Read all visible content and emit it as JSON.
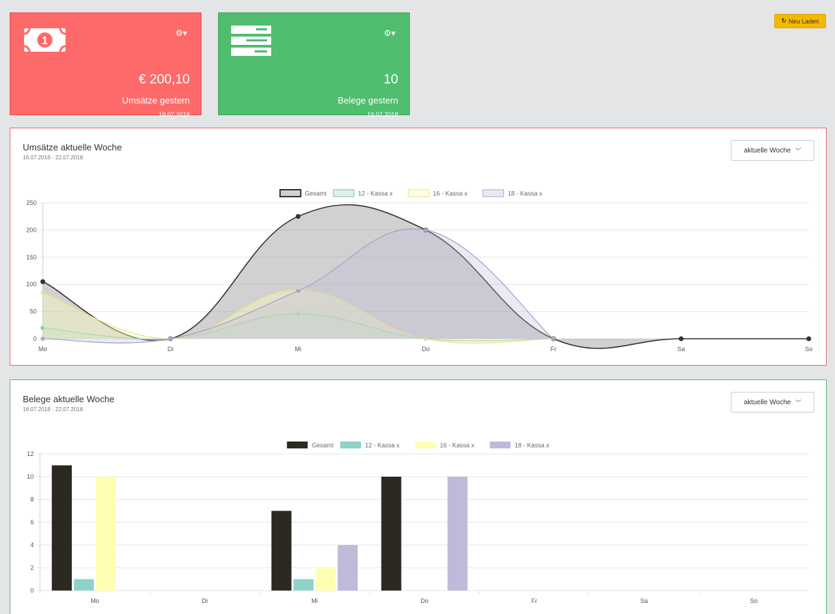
{
  "header": {
    "reload_label": "Neu Laden",
    "reload_icon": "refresh-icon"
  },
  "tiles": [
    {
      "icon": "banknote-icon",
      "value": "€ 200,10",
      "label": "Umsätze gestern",
      "date": "19.07.2018",
      "color": "#fd6a69"
    },
    {
      "icon": "receipts-icon",
      "value": "10",
      "label": "Belege gestern",
      "date": "19.07.2018",
      "color": "#50bd6f"
    }
  ],
  "panels": [
    {
      "title": "Umsätze aktuelle Woche",
      "subtitle": "16.07.2018 - 22.07.2018",
      "dropdown": "aktuelle Woche"
    },
    {
      "title": "Belege aktuelle Woche",
      "subtitle": "16.07.2018 - 22.07.2018",
      "dropdown": "aktuelle Woche"
    }
  ],
  "chart_data": [
    {
      "type": "area",
      "categories": [
        "Mo",
        "Di",
        "Mi",
        "Do",
        "Fr",
        "Sa",
        "So"
      ],
      "ylim": [
        0,
        250
      ],
      "yticks": [
        0,
        50,
        100,
        150,
        200,
        250
      ],
      "legend": "top-center",
      "grid": true,
      "series": [
        {
          "name": "Gesamt",
          "values": [
            105,
            0,
            225,
            200,
            0,
            0,
            0
          ],
          "stroke": "#333333",
          "fill": "rgba(140,140,140,0.4)"
        },
        {
          "name": "12 - Kassa x",
          "values": [
            20,
            0,
            46,
            0,
            0,
            null,
            null
          ],
          "stroke": "#7bbfb0",
          "fill": "rgba(140,210,195,0.3)"
        },
        {
          "name": "16 - Kassa x",
          "values": [
            85,
            0,
            90,
            0,
            0,
            null,
            null
          ],
          "stroke": "#e8e08a",
          "fill": "rgba(255,255,190,0.4)"
        },
        {
          "name": "18 - Kassa x",
          "values": [
            0,
            0,
            88,
            200,
            0,
            null,
            null
          ],
          "stroke": "#a9a4cc",
          "fill": "rgba(190,186,218,0.3)"
        }
      ]
    },
    {
      "type": "bar",
      "categories": [
        "Mo",
        "Di",
        "Mi",
        "Do",
        "Fr",
        "Sa",
        "So"
      ],
      "ylim": [
        0,
        12
      ],
      "yticks": [
        0,
        2,
        4,
        6,
        8,
        10,
        12
      ],
      "legend": "top-center",
      "grid": true,
      "series": [
        {
          "name": "Gesamt",
          "values": [
            11,
            0,
            7,
            10,
            0,
            0,
            0
          ],
          "color": "#2b2922"
        },
        {
          "name": "12 - Kassa x",
          "values": [
            1,
            0,
            1,
            0,
            0,
            0,
            0
          ],
          "color": "#8dd3c7"
        },
        {
          "name": "16 - Kassa x",
          "values": [
            10,
            0,
            2,
            0,
            0,
            0,
            0
          ],
          "color": "#ffffb3"
        },
        {
          "name": "18 - Kassa x",
          "values": [
            0,
            0,
            4,
            10,
            0,
            0,
            0
          ],
          "color": "#bebada"
        }
      ]
    }
  ]
}
